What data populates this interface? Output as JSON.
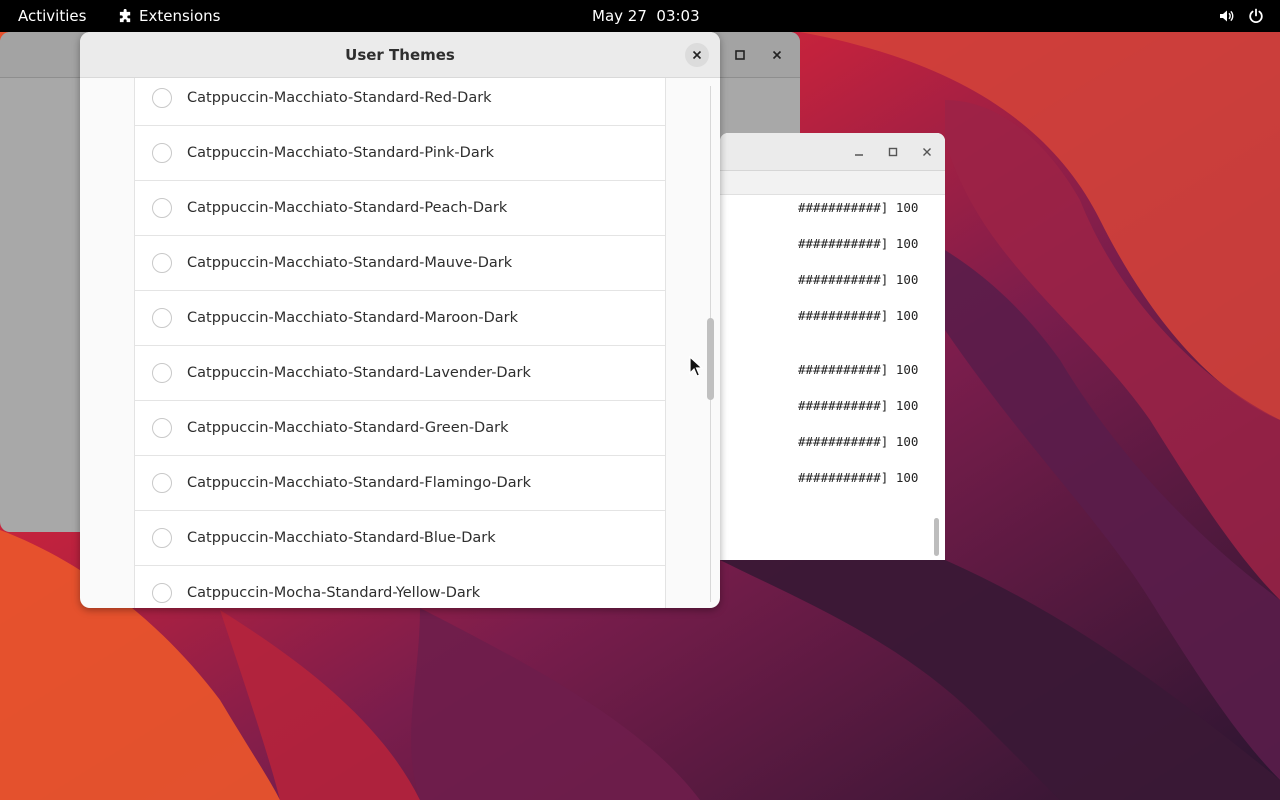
{
  "topbar": {
    "activities": "Activities",
    "app_name": "Extensions",
    "clock": "May 27  03:03",
    "icons": [
      "puzzle-icon",
      "volume-icon",
      "power-icon"
    ]
  },
  "dialog": {
    "title": "User Themes",
    "close_icon": "close-icon",
    "themes": [
      "Catppuccin-Macchiato-Standard-Red-Dark",
      "Catppuccin-Macchiato-Standard-Pink-Dark",
      "Catppuccin-Macchiato-Standard-Peach-Dark",
      "Catppuccin-Macchiato-Standard-Mauve-Dark",
      "Catppuccin-Macchiato-Standard-Maroon-Dark",
      "Catppuccin-Macchiato-Standard-Lavender-Dark",
      "Catppuccin-Macchiato-Standard-Green-Dark",
      "Catppuccin-Macchiato-Standard-Flamingo-Dark",
      "Catppuccin-Macchiato-Standard-Blue-Dark",
      "Catppuccin-Mocha-Standard-Yellow-Dark"
    ]
  },
  "terminal": {
    "lines": [
      "###########] 100",
      "###########] 100",
      "###########] 100",
      "###########] 100",
      "###########] 100",
      "###########] 100",
      "###########] 100",
      "###########] 100"
    ]
  },
  "colors": {
    "topbar_bg": "#000000",
    "wallpaper_red": "#c9283a",
    "wallpaper_purple": "#4a1a48",
    "dialog_bg": "#fafafa"
  }
}
